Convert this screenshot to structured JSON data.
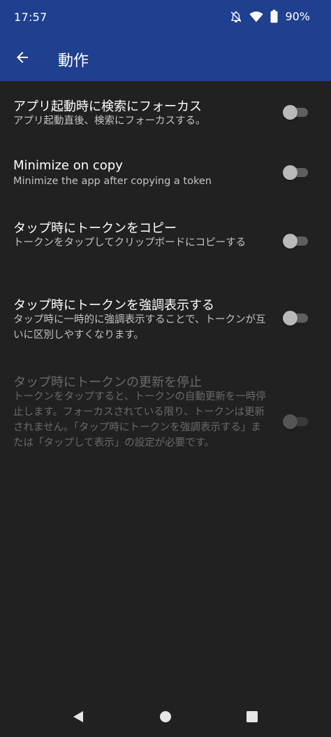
{
  "status_bar": {
    "time": "17:57",
    "battery_percent": "90%",
    "icons": [
      "bell-off-icon",
      "wifi-icon",
      "battery-icon"
    ]
  },
  "app_bar": {
    "back_icon": "arrow-left-icon",
    "title": "動作",
    "color": "#1f3f8f"
  },
  "settings": [
    {
      "title": "アプリ起動時に検索にフォーカス",
      "summary": "アプリ起動直後、検索にフォーカスする。",
      "enabled": true,
      "checked": false
    },
    {
      "title": "Minimize on copy",
      "summary": "Minimize the app after copying a token",
      "enabled": true,
      "checked": false
    },
    {
      "title": "タップ時にトークンをコピー",
      "summary": "トークンをタップしてクリップボードにコピーする",
      "enabled": true,
      "checked": false
    },
    {
      "title": "タップ時にトークンを強調表示する",
      "summary": "タップ時に一時的に強調表示することで、トークンが互いに区別しやすくなります。",
      "enabled": true,
      "checked": false
    },
    {
      "title": "タップ時にトークンの更新を停止",
      "summary": "トークンをタップすると、トークンの自動更新を一時停止します。フォーカスされている限り、トークンは更新されません。「タップ時にトークンを強調表示する」または「タップして表示」の設定が必要です。",
      "enabled": false,
      "checked": false
    }
  ],
  "nav_bar": {
    "icons": [
      "back-triangle-icon",
      "home-circle-icon",
      "recents-square-icon"
    ]
  }
}
